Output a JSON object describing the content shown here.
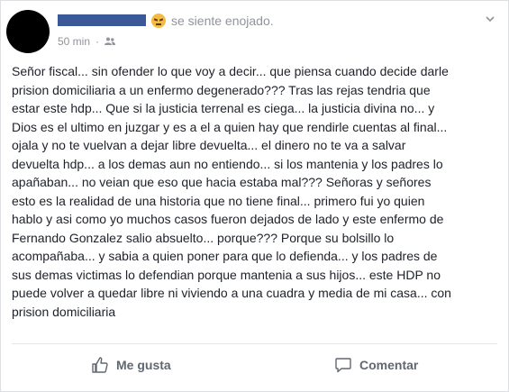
{
  "header": {
    "feeling": "se siente enojado.",
    "timestamp": "50 min",
    "separator": "·"
  },
  "post": {
    "text": "Señor fiscal... sin ofender lo que voy a decir... que piensa cuando decide darle\nprision domiciliaria a un enfermo degenerado??? Tras las rejas tendria que\nestar este hdp... Que si la justicia terrenal es ciega... la justicia divina no... y\nDios es el ultimo en juzgar y es a el a quien hay que rendirle cuentas al final...\nojala y no te vuelvan a dejar libre devuelta... el dinero no te va a salvar\ndevuelta hdp... a los demas aun no entiendo... si los mantenia y los padres lo\napañaban... no veian que eso que hacia estaba mal??? Señoras y señores\nesto es la realidad de una historia que no tiene final... primero fui yo quien\nhablo y asi como yo muchos casos fueron dejados de lado y este enfermo de\nFernando Gonzalez salio absuelto... porque??? Porque su bolsillo lo\nacompañaba... y sabia a quien poner para que lo defienda... y los padres de\nsus demas victimas lo defendian porque mantenia a sus hijos... este HDP no\npuede volver a quedar libre ni viviendo a una cuadra y media de mi casa... con\nprision domiciliaria"
  },
  "actions": {
    "like_label": "Me gusta",
    "comment_label": "Comentar"
  },
  "icons": {
    "emoji": "angry-face-icon",
    "audience": "friends-icon",
    "menu": "chevron-down-icon",
    "like": "thumbs-up-icon",
    "comment": "speech-bubble-icon"
  },
  "colors": {
    "name_bar": "#3b5998",
    "muted": "#90949c",
    "action_text": "#606770"
  }
}
